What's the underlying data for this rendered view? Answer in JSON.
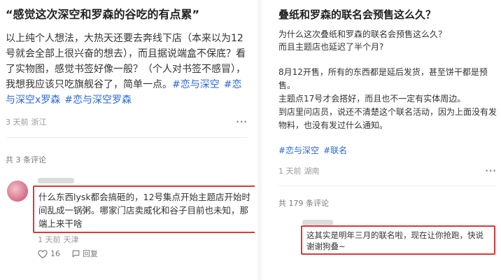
{
  "left": {
    "title": "“感觉这次深空和罗森的谷吃的有点累”",
    "body": "以上纯个人想法，大热天还要去奔线下店（本来以为12号就会全部上很兴奋的想去），而且据说端盒不保底？看了实物图，感觉书签好像一般？（个人对书签不感冒），我想我应该只吃旗舰谷了，简单一点。",
    "hashtags": [
      "#恋与深空",
      "#恋与深空x罗森",
      "#恋与深空罗森"
    ],
    "meta": {
      "time": "3 天前",
      "location": "浙江"
    },
    "comment_count": "共 3 条评论",
    "comment": {
      "text": "什么东西lysk都会搞砸的，12号集点开始主题店开始时间乱成一锅粥。哪家门店卖威化和谷子目前也未知，那端上来干啥",
      "time": "1 天前",
      "location": "天津",
      "likes": "16",
      "reply_label": "回复"
    }
  },
  "right": {
    "title": "叠纸和罗森的联名会预售这么久？",
    "intro": [
      "为什么这次叠纸和罗森的联名会预售这么久？",
      "而且主题店也延迟了半个月?"
    ],
    "details": [
      "8月12开售，所有的东西都是延后发货，甚至饼干都是预售。",
      "主题点17号才会搭好，而且也不一定有实体周边。",
      "到店里问店员，说还不清楚这个联名活动，因为上面没有发物料，也没有发过什么通知。"
    ],
    "hashtags": [
      "#恋与深空",
      "#联名"
    ],
    "meta": {
      "time": "1 天前",
      "location": "湖南"
    },
    "comment_count": "共 179 条评论",
    "comment": {
      "text": "这其实是明年三月的联名啦，现在让你抢跑，快说谢谢狗叠~"
    }
  },
  "icons": [
    "heart-icon",
    "reply-icon",
    "more-icon"
  ],
  "colors": {
    "highlight_border": "#d63b3b",
    "hashtag": "#2b68d8"
  }
}
